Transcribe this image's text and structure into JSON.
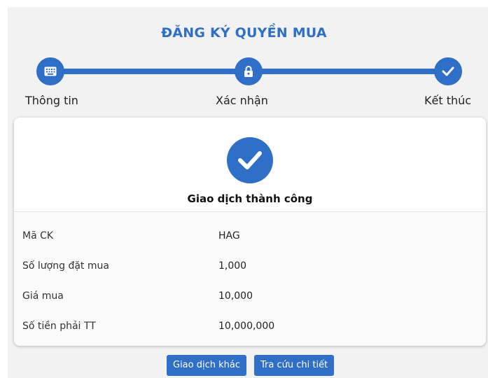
{
  "title": "ĐĂNG KÝ QUYỀN MUA",
  "steps": [
    {
      "label": "Thông tin",
      "icon": "keyboard-icon"
    },
    {
      "label": "Xác nhận",
      "icon": "lock-icon"
    },
    {
      "label": "Kết thúc",
      "icon": "check-icon"
    }
  ],
  "result": {
    "message": "Giao dịch thành công",
    "icon": "check-circle-icon"
  },
  "details": [
    {
      "label": "Mã CK",
      "value": "HAG"
    },
    {
      "label": "Số lượng đặt mua",
      "value": "1,000"
    },
    {
      "label": "Giá mua",
      "value": "10,000"
    },
    {
      "label": "Số tiền phải TT",
      "value": "10,000,000"
    }
  ],
  "buttons": {
    "other_transaction": "Giao dịch khác",
    "view_details": "Tra cứu chi tiết"
  },
  "colors": {
    "accent": "#2f6fc7",
    "panel_bg": "#f2f2f2",
    "card_bg": "#fafafa"
  }
}
